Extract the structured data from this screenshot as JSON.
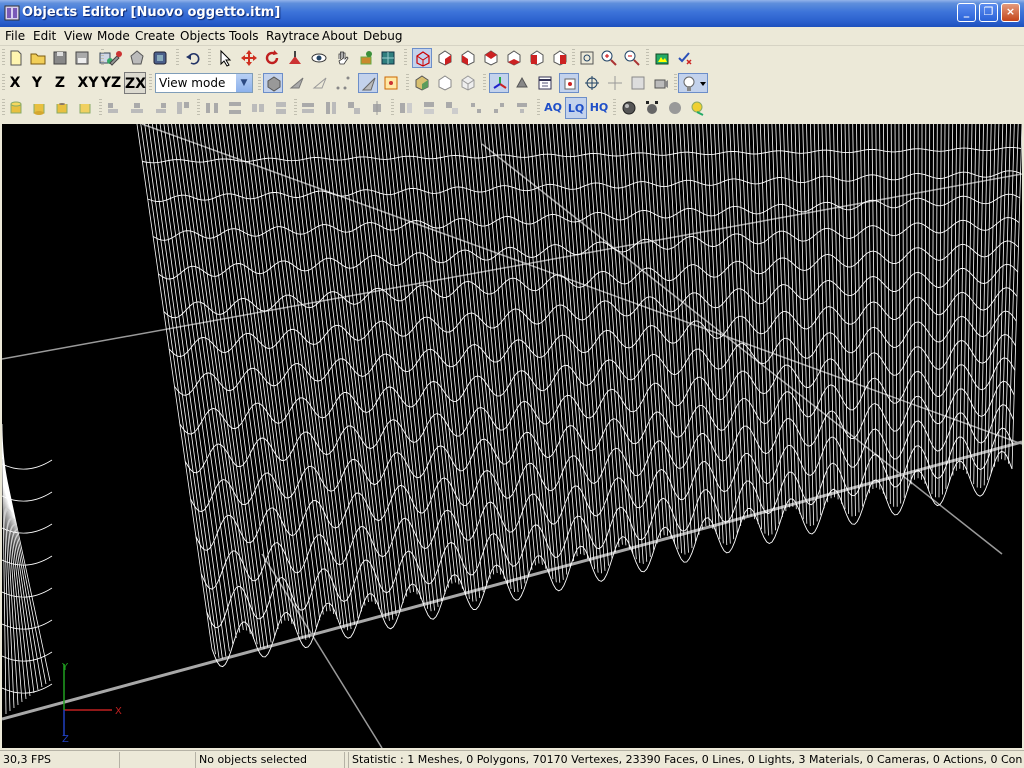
{
  "window": {
    "title": "Objects Editor [Nuovo oggetto.itm]",
    "minimize_glyph": "_",
    "maximize_glyph": "❐",
    "close_glyph": "×"
  },
  "menu": [
    "File",
    "Edit",
    "View",
    "Mode",
    "Create",
    "Objects",
    "Tools",
    "Raytrace",
    "About",
    "Debug"
  ],
  "toolbar2": {
    "axes": [
      "X",
      "Y",
      "Z",
      "XY",
      "YZ",
      "ZX"
    ],
    "active_axis": "ZX",
    "mode_select": "View mode"
  },
  "toolbar3": {
    "quality": [
      "AQ",
      "LQ",
      "HQ"
    ],
    "active_quality": "LQ"
  },
  "viewport": {
    "gizmo_x_label": "X",
    "gizmo_y_label": "Y",
    "gizmo_z_label": "Z",
    "wire_color": "#ffffff",
    "floor_line_color": "#a8a8a8"
  },
  "status": {
    "fps": "30,3 FPS",
    "selection": "No objects selected",
    "statistic": "Statistic : 1 Meshes, 0 Polygons, 70170 Vertexes, 23390 Faces, 0 Lines, 0 Lights, 3 Materials, 0 Cameras, 0 Actions, 0 Contain"
  },
  "colors": {
    "titlebar_blue": "#2a5fcc",
    "chrome": "#ece9d8",
    "quality_text": "#1f4fc8",
    "viewport_bg": "#000000"
  }
}
